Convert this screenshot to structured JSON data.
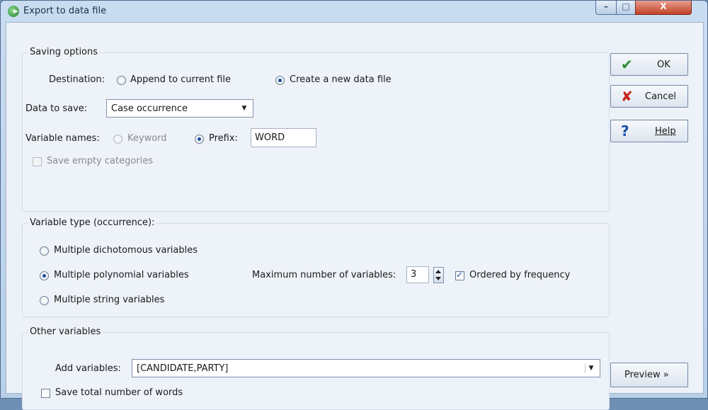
{
  "window": {
    "title": "Export to data file",
    "close_glyph": "X"
  },
  "saving": {
    "legend": "Saving options",
    "destination_label": "Destination:",
    "append_label": "Append to current file",
    "create_label": "Create a new data file",
    "data_to_save_label": "Data to save:",
    "data_to_save_value": "Case occurrence",
    "varnames_label": "Variable names:",
    "keyword_label": "Keyword",
    "prefix_label": "Prefix:",
    "prefix_value": "WORD",
    "save_empty_label": "Save empty categories"
  },
  "vartype": {
    "legend": "Variable type (occurrence):",
    "dichotomous_label": "Multiple dichotomous variables",
    "polynomial_label": "Multiple polynomial variables",
    "string_label": "Multiple string variables",
    "max_label": "Maximum number of variables:",
    "max_value": "3",
    "ordered_label": "Ordered by frequency"
  },
  "other": {
    "legend": "Other variables",
    "add_label": "Add variables:",
    "add_value": "[CANDIDATE,PARTY]",
    "save_total_label": "Save total number of words"
  },
  "buttons": {
    "ok": "OK",
    "cancel_label": "Cancel",
    "help": "Help",
    "preview": "Preview »"
  },
  "icons": {
    "ok": "check-icon",
    "cancel": "x-icon",
    "help": "question-icon"
  }
}
